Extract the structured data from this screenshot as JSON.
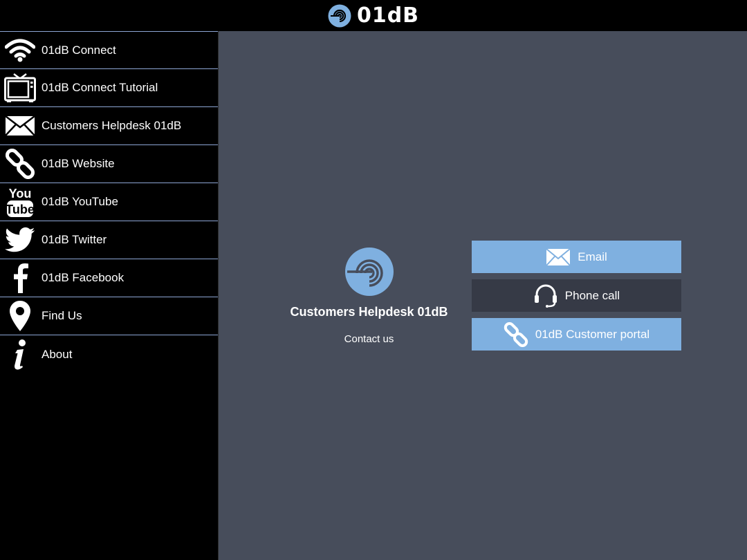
{
  "header": {
    "brand": "01dB"
  },
  "sidebar": {
    "items": [
      {
        "icon": "wifi-icon",
        "label": "01dB Connect"
      },
      {
        "icon": "tv-icon",
        "label": "01dB Connect Tutorial"
      },
      {
        "icon": "envelope-icon",
        "label": "Customers Helpdesk 01dB"
      },
      {
        "icon": "link-icon",
        "label": "01dB Website"
      },
      {
        "icon": "youtube-icon",
        "label": "01dB YouTube"
      },
      {
        "icon": "twitter-icon",
        "label": "01dB Twitter"
      },
      {
        "icon": "facebook-icon",
        "label": "01dB Facebook"
      },
      {
        "icon": "location-pin-icon",
        "label": "Find Us"
      },
      {
        "icon": "info-icon",
        "label": "About"
      }
    ]
  },
  "main": {
    "title": "Customers Helpdesk 01dB",
    "subtitle": "Contact us",
    "actions": {
      "email": "Email",
      "phone": "Phone call",
      "portal": "01dB Customer portal"
    }
  },
  "colors": {
    "accent": "#7fb0e0",
    "main_bg": "#474d5b",
    "dark_button": "#363a46",
    "divider": "#8ea7d6"
  }
}
